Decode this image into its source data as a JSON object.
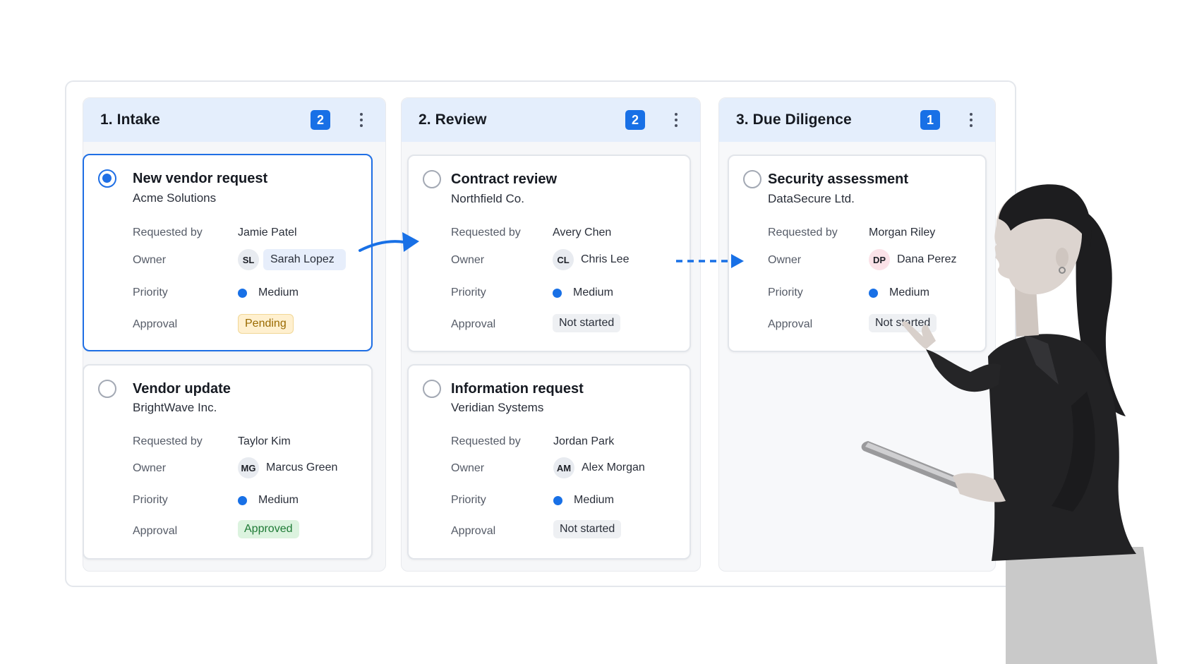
{
  "colors": {
    "accent": "#1870e6",
    "header_bg": "#e4eefc",
    "pending_bg": "#fff0cf",
    "approved_bg": "#dcf3df"
  },
  "columns": [
    {
      "title": "1. Intake",
      "count": "2",
      "cards": [
        {
          "title": "New vendor request",
          "company": "Acme Solutions",
          "requested_by_label": "Requested by",
          "requested_by": "Jamie Patel",
          "owner_label": "Owner",
          "owner_initials": "SL",
          "owner_name": "Sarah Lopez",
          "priority_label": "Priority",
          "priority": "Medium",
          "approval_label": "Approval",
          "approval": "Pending"
        },
        {
          "title": "Vendor update",
          "company": "BrightWave Inc.",
          "requested_by_label": "Requested by",
          "requested_by": "Taylor Kim",
          "owner_label": "Owner",
          "owner_initials": "MG",
          "owner_name": "Marcus Green",
          "priority_label": "Priority",
          "priority": "Medium",
          "approval_label": "Approval",
          "approval": "Approved"
        }
      ]
    },
    {
      "title": "2. Review",
      "count": "2",
      "cards": [
        {
          "title": "Contract review",
          "company": "Northfield Co.",
          "requested_by_label": "Requested by",
          "requested_by": "Avery Chen",
          "owner_label": "Owner",
          "owner_initials": "CL",
          "owner_name": "Chris Lee",
          "priority_label": "Priority",
          "priority": "Medium",
          "approval_label": "Approval",
          "approval": "Not started"
        },
        {
          "title": "Information request",
          "company": "Veridian Systems",
          "requested_by_label": "Requested by",
          "requested_by": "Jordan Park",
          "owner_label": "Owner",
          "owner_initials": "AM",
          "owner_name": "Alex Morgan",
          "priority_label": "Priority",
          "priority": "Medium",
          "approval_label": "Approval",
          "approval": "Not started"
        }
      ]
    },
    {
      "title": "3. Due Diligence",
      "count": "1",
      "cards": [
        {
          "title": "Security assessment",
          "company": "DataSecure Ltd.",
          "requested_by_label": "Requested by",
          "requested_by": "Morgan Riley",
          "owner_label": "Owner",
          "owner_initials": "DP",
          "owner_name": "Dana Perez",
          "priority_label": "Priority",
          "priority": "Medium",
          "approval_label": "Approval",
          "approval": "Not started"
        }
      ]
    }
  ]
}
